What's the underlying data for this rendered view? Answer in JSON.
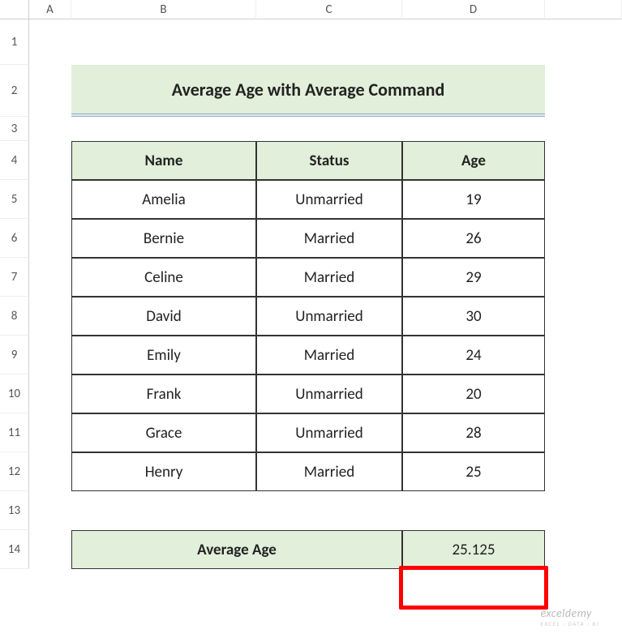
{
  "columns": [
    "A",
    "B",
    "C",
    "D"
  ],
  "rows": [
    "1",
    "2",
    "3",
    "4",
    "5",
    "6",
    "7",
    "8",
    "9",
    "10",
    "11",
    "12",
    "13",
    "14"
  ],
  "title": "Average Age with Average Command",
  "table": {
    "headers": [
      "Name",
      "Status",
      "Age"
    ],
    "rows": [
      {
        "name": "Amelia",
        "status": "Unmarried",
        "age": "19"
      },
      {
        "name": "Bernie",
        "status": "Married",
        "age": "26"
      },
      {
        "name": "Celine",
        "status": "Married",
        "age": "29"
      },
      {
        "name": "David",
        "status": "Unmarried",
        "age": "30"
      },
      {
        "name": "Emily",
        "status": "Married",
        "age": "24"
      },
      {
        "name": "Frank",
        "status": "Unmarried",
        "age": "20"
      },
      {
        "name": "Grace",
        "status": "Unmarried",
        "age": "28"
      },
      {
        "name": "Henry",
        "status": "Married",
        "age": "25"
      }
    ]
  },
  "average": {
    "label": "Average Age",
    "value": "25.125"
  },
  "watermark": {
    "main": "exceldemy",
    "sub": "EXCEL · DATA · BI"
  },
  "chart_data": {
    "type": "table",
    "title": "Average Age with Average Command",
    "columns": [
      "Name",
      "Status",
      "Age"
    ],
    "rows": [
      [
        "Amelia",
        "Unmarried",
        19
      ],
      [
        "Bernie",
        "Married",
        26
      ],
      [
        "Celine",
        "Married",
        29
      ],
      [
        "David",
        "Unmarried",
        30
      ],
      [
        "Emily",
        "Married",
        24
      ],
      [
        "Frank",
        "Unmarried",
        20
      ],
      [
        "Grace",
        "Unmarried",
        28
      ],
      [
        "Henry",
        "Married",
        25
      ]
    ],
    "summary": {
      "label": "Average Age",
      "value": 25.125
    }
  }
}
